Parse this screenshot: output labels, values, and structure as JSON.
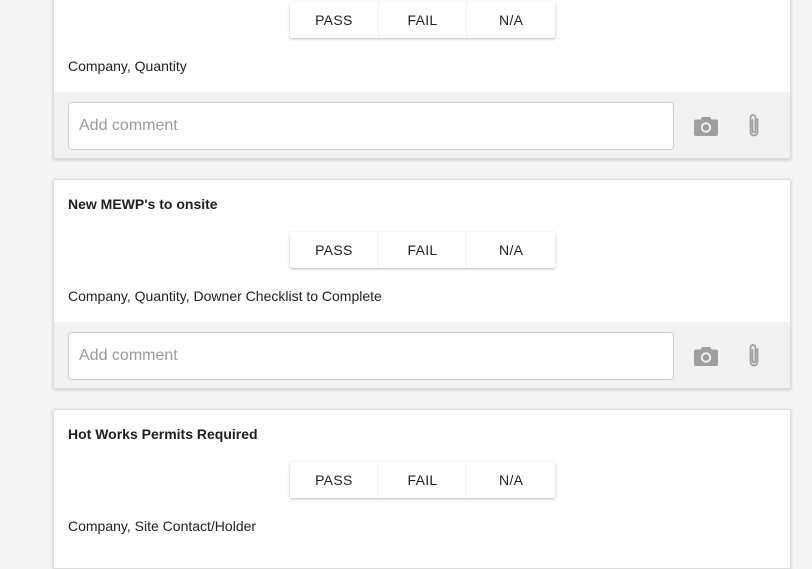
{
  "checklist": {
    "buttons": {
      "pass": "PASS",
      "fail": "FAIL",
      "na": "N/A"
    },
    "comment_placeholder": "Add comment",
    "items": [
      {
        "title": "",
        "description": "Company, Quantity"
      },
      {
        "title": "New MEWP's to onsite",
        "description": "Company, Quantity, Downer Checklist to Complete"
      },
      {
        "title": "Hot Works Permits Required",
        "description": "Company, Site Contact/Holder"
      }
    ]
  },
  "icons": {
    "camera": "camera-icon",
    "attach": "paperclip-icon"
  },
  "colors": {
    "icon_gray": "#9e9e9e",
    "comment_bg": "#f2f2f2",
    "page_bg": "#f5f5f5"
  }
}
